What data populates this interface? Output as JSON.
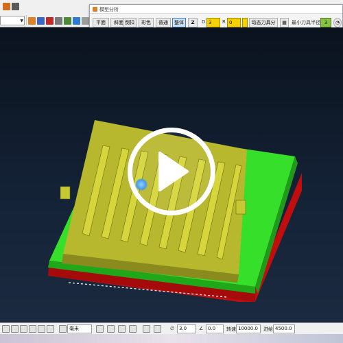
{
  "toolbar": {
    "combo_value": "",
    "icons": [
      "tool-icon",
      "select-icon",
      "delete-icon",
      "list-icon",
      "grid-icon",
      "fit-view-icon",
      "move-icon",
      "paste-icon",
      "snap-icon"
    ]
  },
  "panel": {
    "title": "模型分析",
    "buttons": [
      "平面",
      "斜面",
      "倒扣",
      "彩色",
      "普通",
      "整体"
    ],
    "active_button": "整体",
    "d_label": "D",
    "d_value": "3",
    "r_label": "R",
    "r_value": "0",
    "tool_button": "动态刀具分析",
    "min_radius_label": "最小刀具半径:",
    "min_radius_value": "3"
  },
  "viewport": {
    "background_color": "#0d1826",
    "model_colors": {
      "top": "#c8c832",
      "base": "#36e02a",
      "bottom": "#c00e0e"
    },
    "overlay": "play-button-icon"
  },
  "status": {
    "unit": "毫米",
    "angle_value": "3.0",
    "offset_value": "0.0",
    "feed_label": "转速",
    "feed_value": "10000.0",
    "speed_label": "进给",
    "speed_value": "4500.0"
  }
}
